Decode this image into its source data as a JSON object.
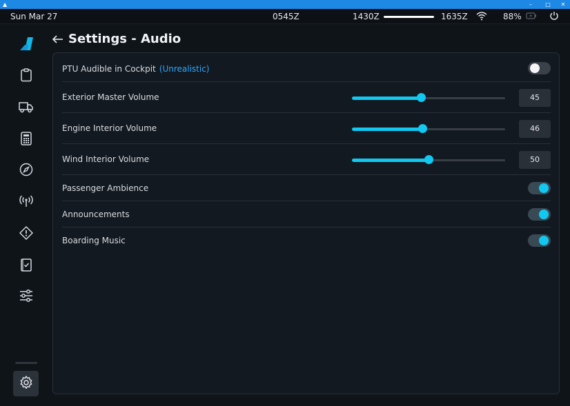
{
  "status_bar": {
    "date": "Sun Mar 27",
    "time_zulu": "0545Z",
    "flight_start": "1430Z",
    "flight_end": "1635Z",
    "flight_progress_percent": 100,
    "battery": "88%"
  },
  "header": {
    "title": "Settings - Audio"
  },
  "settings": [
    {
      "type": "toggle",
      "label": "PTU Audible in Cockpit",
      "note": "(Unrealistic)",
      "on": false
    },
    {
      "type": "slider",
      "label": "Exterior Master Volume",
      "value": "45",
      "fraction": 0.45
    },
    {
      "type": "slider",
      "label": "Engine Interior Volume",
      "value": "46",
      "fraction": 0.46
    },
    {
      "type": "slider",
      "label": "Wind Interior Volume",
      "value": "50",
      "fraction": 0.5
    },
    {
      "type": "toggle",
      "label": "Passenger Ambience",
      "on": true
    },
    {
      "type": "toggle",
      "label": "Announcements",
      "on": true
    },
    {
      "type": "toggle",
      "label": "Boarding Music",
      "on": true
    }
  ],
  "icons": {
    "nav": [
      "clipboard-icon",
      "truck-icon",
      "calculator-icon",
      "compass-icon",
      "antenna-icon",
      "warning-icon",
      "checklist-icon",
      "sliders-icon"
    ],
    "footer": "gear-icon"
  },
  "colors": {
    "accent": "#12c8f0",
    "link": "#2aa8ff",
    "window_bar": "#1e88e5"
  }
}
